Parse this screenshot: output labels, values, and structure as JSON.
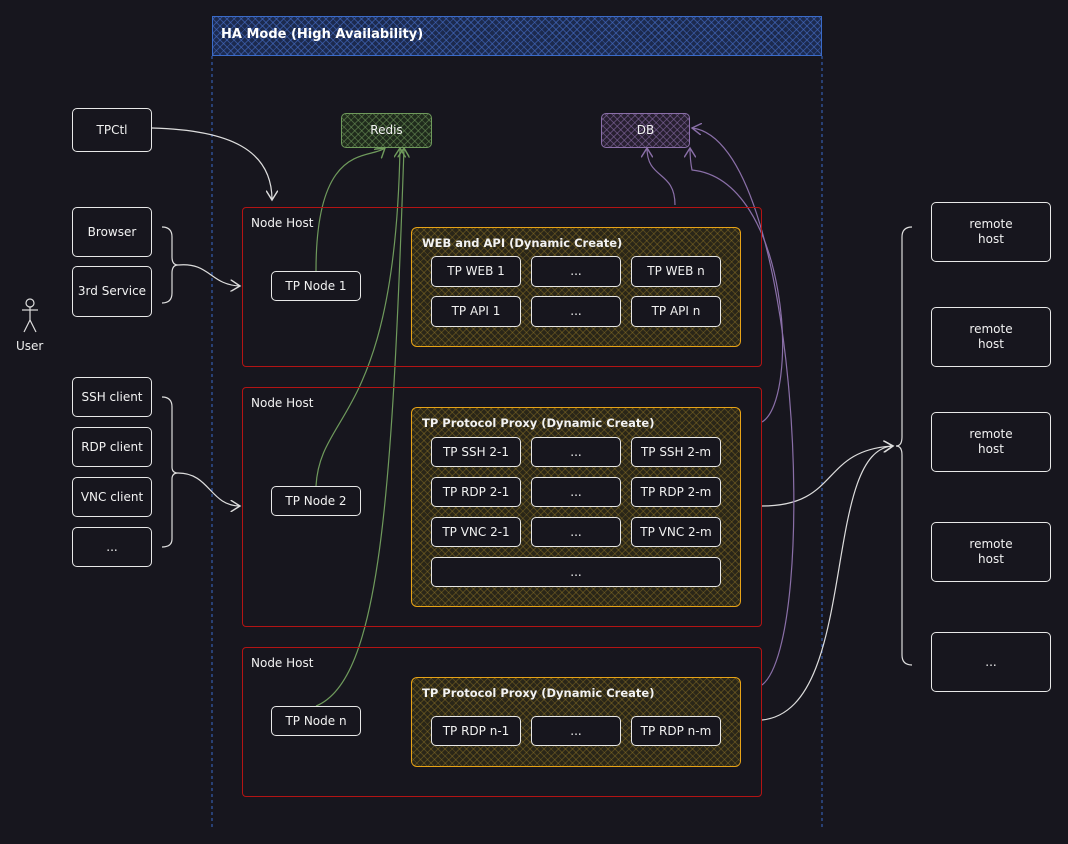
{
  "ha_title": "HA Mode (High Availability)",
  "user": "User",
  "clients": {
    "tpctl": "TPCtl",
    "browser": "Browser",
    "third": "3rd Service",
    "ssh": "SSH client",
    "rdp": "RDP client",
    "vnc": "VNC client",
    "more": "..."
  },
  "redis": "Redis",
  "db": "DB",
  "hosts": [
    {
      "title": "Node Host",
      "node": "TP Node 1",
      "group": "WEB and API (Dynamic Create)",
      "cells": [
        "TP WEB 1",
        "...",
        "TP WEB n",
        "TP API 1",
        "...",
        "TP API n"
      ]
    },
    {
      "title": "Node Host",
      "node": "TP Node 2",
      "group": "TP Protocol Proxy (Dynamic Create)",
      "cells": [
        "TP SSH 2-1",
        "...",
        "TP SSH 2-m",
        "TP RDP 2-1",
        "...",
        "TP RDP 2-m",
        "TP VNC 2-1",
        "...",
        "TP VNC 2-m",
        "..."
      ]
    },
    {
      "title": "Node Host",
      "node": "TP Node n",
      "group": "TP Protocol Proxy (Dynamic Create)",
      "cells": [
        "TP RDP n-1",
        "...",
        "TP RDP n-m"
      ]
    }
  ],
  "remotes": [
    "remote host",
    "remote host",
    "remote host",
    "remote host",
    "..."
  ],
  "colors": {
    "ha": "#3a6bc9",
    "host": "#b31414",
    "group": "#e8a317",
    "redis": "#6f9a5c",
    "db": "#8a6fa8"
  }
}
